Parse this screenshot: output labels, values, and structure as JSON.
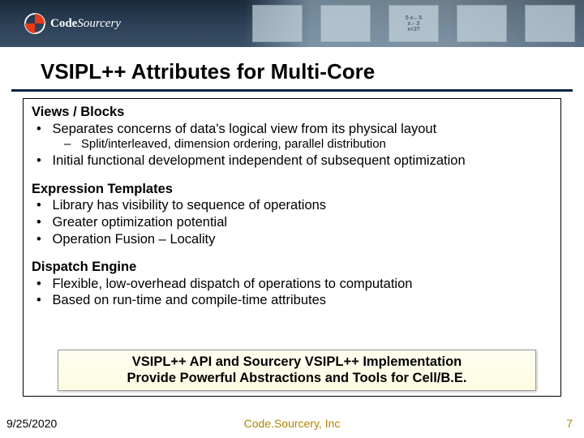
{
  "logo": {
    "brand_a": "Code",
    "brand_b": "Sourcery"
  },
  "title": "VSIPL++ Attributes for Multi-Core",
  "sections": [
    {
      "head": "Views / Blocks",
      "bullets": [
        "Separates concerns of data's logical view from its physical layout"
      ],
      "subs": [
        "Split/interleaved, dimension ordering, parallel distribution"
      ],
      "bullets2": [
        "Initial functional development independent of subsequent optimization"
      ]
    },
    {
      "head": "Expression Templates",
      "bullets": [
        "Library has visibility to sequence of operations",
        "Greater optimization potential",
        "Operation Fusion – Locality"
      ]
    },
    {
      "head": "Dispatch Engine",
      "bullets": [
        "Flexible, low-overhead dispatch of operations to computation",
        "Based on run-time and compile-time attributes"
      ]
    }
  ],
  "callout": {
    "line1": "VSIPL++ API and Sourcery VSIPL++ Implementation",
    "line2": "Provide Powerful Abstractions and Tools for Cell/B.E."
  },
  "footer": {
    "date": "9/25/2020",
    "org": "Code.Sourcery, Inc",
    "page": "7"
  }
}
